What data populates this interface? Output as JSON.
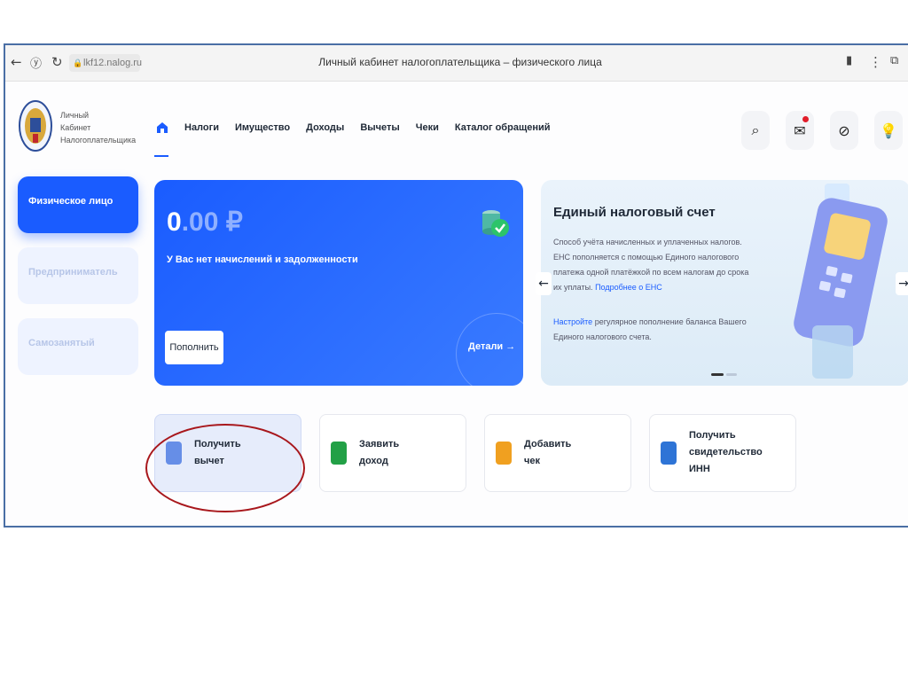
{
  "browser": {
    "url": "lkf12.nalog.ru",
    "page_title": "Личный кабинет налогоплательщика – физического лица"
  },
  "header": {
    "logo_lines": [
      "Личный",
      "Кабинет",
      "Налогоплательщика"
    ],
    "nav": [
      "Налоги",
      "Имущество",
      "Доходы",
      "Вычеты",
      "Чеки",
      "Каталог обращений"
    ]
  },
  "sidebar": {
    "items": [
      {
        "label": "Физическое лицо",
        "active": true
      },
      {
        "label": "Предприниматель",
        "active": false
      },
      {
        "label": "Самозанятый",
        "active": false
      }
    ]
  },
  "balance": {
    "amount_int": "0",
    "amount_dec": ".00 ₽",
    "subtitle": "У Вас нет начислений и задолженности",
    "topup_label": "Пополнить",
    "details_label": "Детали →"
  },
  "ens": {
    "title": "Единый налоговый счет",
    "desc": "Способ учёта начисленных и уплаченных налогов. ЕНС пополняется с помощью Единого налогового платежа одной платёжкой по всем налогам до срока их уплаты.",
    "desc_link": "Подробнее о ЕНС",
    "setup_link": "Настройте",
    "setup_text": "регулярное пополнение баланса Вашего Единого налогового счета."
  },
  "tiles": [
    {
      "lines": [
        "Получить",
        "вычет"
      ],
      "color": "#3b6fe0"
    },
    {
      "lines": [
        "Заявить",
        "доход"
      ],
      "color": "#22a046"
    },
    {
      "lines": [
        "Добавить",
        "чек"
      ],
      "color": "#f0a020"
    },
    {
      "lines": [
        "Получить",
        "свидетельство",
        "ИНН"
      ],
      "color": "#2e74d6"
    }
  ]
}
